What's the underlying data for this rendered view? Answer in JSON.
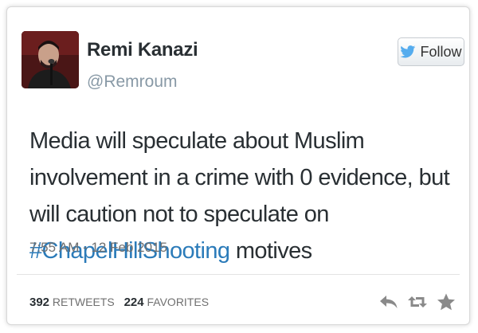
{
  "user": {
    "name": "Remi Kanazi",
    "handle": "@Remroum"
  },
  "follow_button": {
    "label": "Follow",
    "icon": "twitter-bird-icon"
  },
  "tweet": {
    "text_before": "Media will speculate about Muslim involvement in a crime with 0 evidence, but will caution not to speculate on ",
    "hashtag": "#ChapelHillShooting",
    "text_after": " motives",
    "timestamp": "7:55 AM - 12 Feb 2015"
  },
  "stats": {
    "retweets_count": "392",
    "retweets_label": "RETWEETS",
    "favorites_count": "224",
    "favorites_label": "FAVORITES"
  },
  "actions": [
    "reply-icon",
    "retweet-icon",
    "favorite-star-icon"
  ],
  "colors": {
    "hashtag": "#2b7bb9",
    "text": "#292f33",
    "muted": "#8899a6",
    "twitter_blue": "#55acee"
  }
}
